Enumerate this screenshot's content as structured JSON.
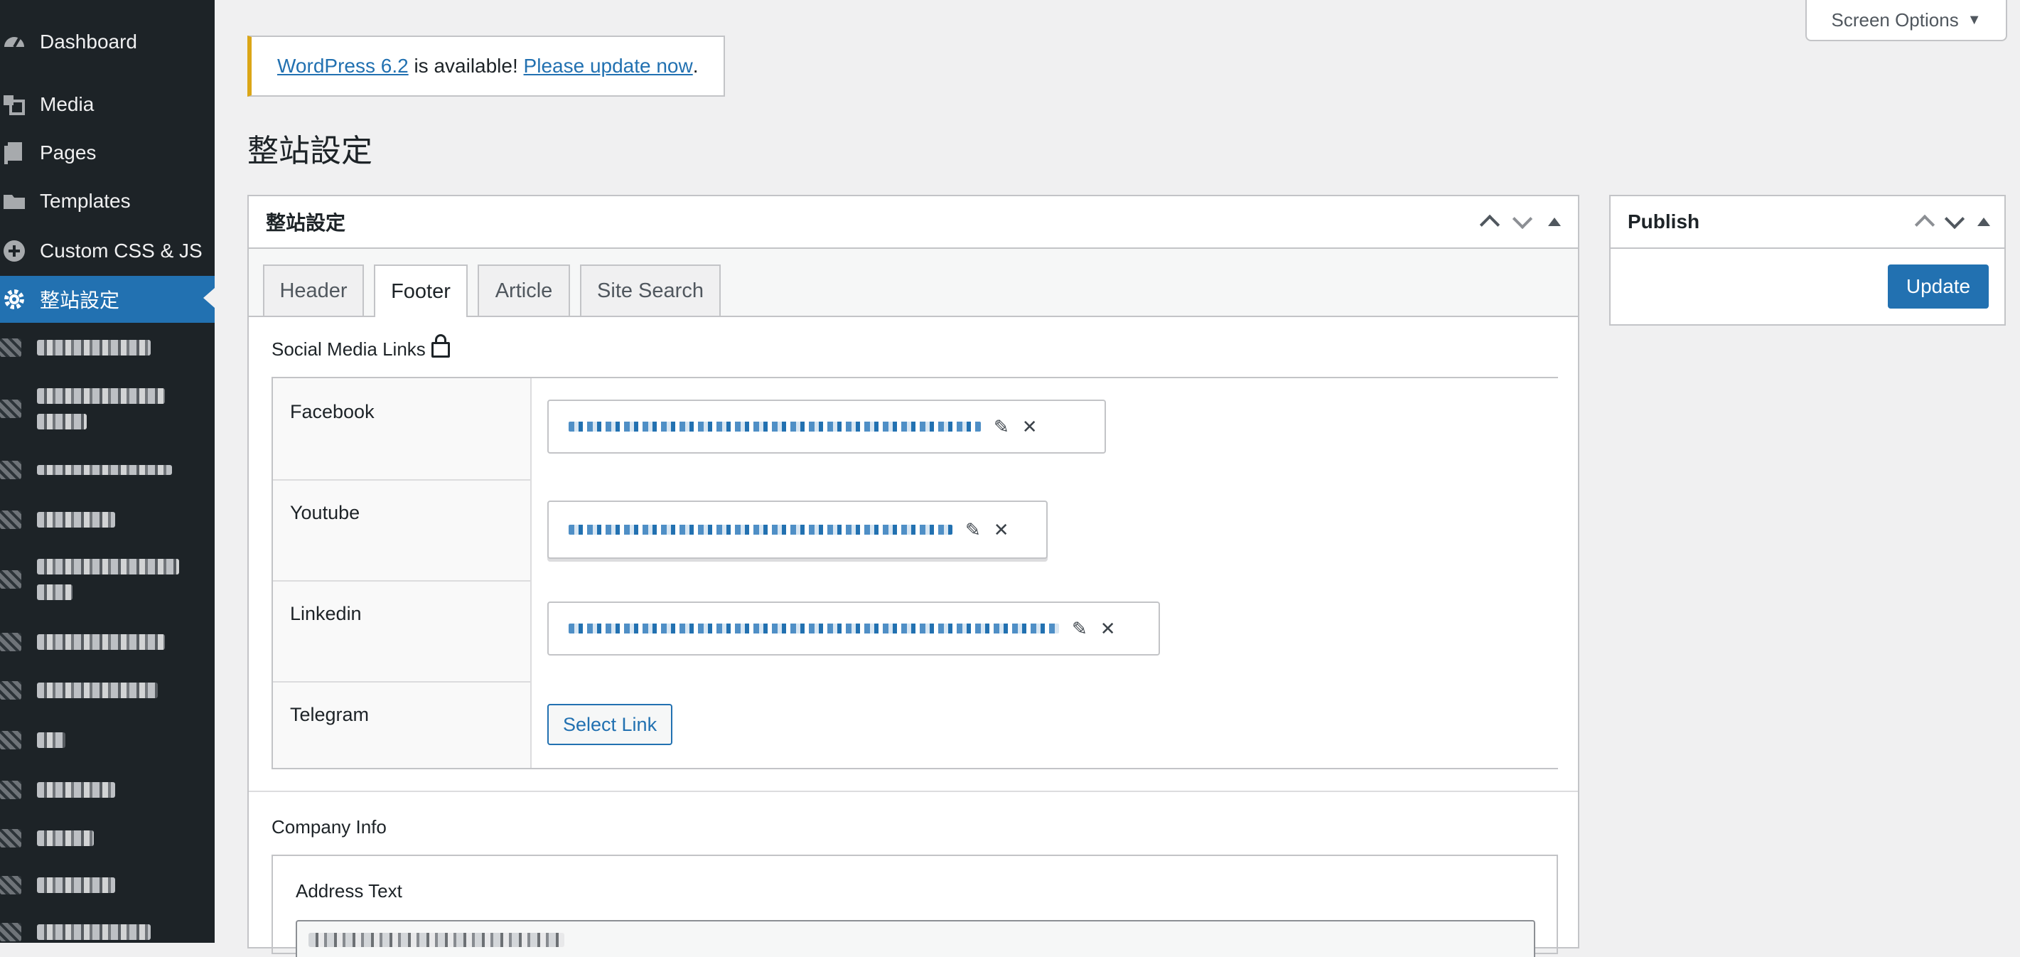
{
  "sidebar": {
    "items": [
      {
        "label": "Dashboard",
        "icon": "dashboard-icon"
      },
      {
        "label": "Media",
        "icon": "media-icon"
      },
      {
        "label": "Pages",
        "icon": "pages-icon"
      },
      {
        "label": "Templates",
        "icon": "folder-icon"
      },
      {
        "label": "Custom CSS & JS",
        "icon": "plus-circle-icon"
      },
      {
        "label": "整站設定",
        "icon": "gear-icon",
        "active": true
      }
    ]
  },
  "screen_options": {
    "label": "Screen Options"
  },
  "notice": {
    "version_link": "WordPress 6.2",
    "middle_text": " is available! ",
    "update_link": "Please update now",
    "end_text": "."
  },
  "page_title": "整站設定",
  "postbox": {
    "title": "整站設定",
    "tabs": [
      "Header",
      "Footer",
      "Article",
      "Site Search"
    ],
    "active_tab": "Footer",
    "social_section_label": "Social Media Links",
    "social_rows": [
      {
        "label": "Facebook"
      },
      {
        "label": "Youtube"
      },
      {
        "label": "Linkedin"
      },
      {
        "label": "Telegram",
        "button": "Select Link"
      }
    ],
    "company_section_label": "Company Info",
    "address_label": "Address Text"
  },
  "publish": {
    "title": "Publish",
    "update_label": "Update"
  },
  "colors": {
    "admin_bar": "#1d2327",
    "accent": "#2271b1",
    "notice_warning": "#dba617"
  }
}
